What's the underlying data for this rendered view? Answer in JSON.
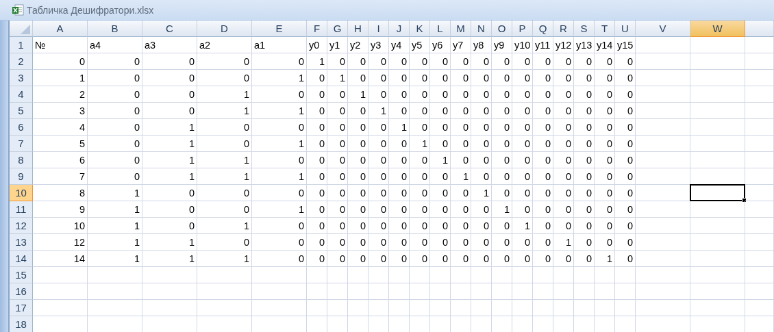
{
  "window": {
    "title": "Табличка Дешифратори.xlsx"
  },
  "columns": [
    {
      "label": "A",
      "selected": false
    },
    {
      "label": "B",
      "selected": false
    },
    {
      "label": "C",
      "selected": false
    },
    {
      "label": "D",
      "selected": false
    },
    {
      "label": "E",
      "selected": false
    },
    {
      "label": "F",
      "selected": false
    },
    {
      "label": "G",
      "selected": false
    },
    {
      "label": "H",
      "selected": false
    },
    {
      "label": "I",
      "selected": false
    },
    {
      "label": "J",
      "selected": false
    },
    {
      "label": "K",
      "selected": false
    },
    {
      "label": "L",
      "selected": false
    },
    {
      "label": "M",
      "selected": false
    },
    {
      "label": "N",
      "selected": false
    },
    {
      "label": "O",
      "selected": false
    },
    {
      "label": "P",
      "selected": false
    },
    {
      "label": "Q",
      "selected": false
    },
    {
      "label": "R",
      "selected": false
    },
    {
      "label": "S",
      "selected": false
    },
    {
      "label": "T",
      "selected": false
    },
    {
      "label": "U",
      "selected": false
    },
    {
      "label": "V",
      "selected": false
    },
    {
      "label": "W",
      "selected": true
    }
  ],
  "rows": [
    {
      "header": "1",
      "selected": false,
      "kind": "text",
      "cells": [
        "№",
        "a4",
        "a3",
        "a2",
        "a1",
        "y0",
        "y1",
        "y2",
        "y3",
        "y4",
        "y5",
        "y6",
        "y7",
        "y8",
        "y9",
        "y10",
        "y11",
        "y12",
        "y13",
        "y14",
        "y15"
      ]
    },
    {
      "header": "2",
      "selected": false,
      "kind": "number",
      "cells": [
        "0",
        "0",
        "0",
        "0",
        "0",
        "1",
        "0",
        "0",
        "0",
        "0",
        "0",
        "0",
        "0",
        "0",
        "0",
        "0",
        "0",
        "0",
        "0",
        "0",
        "0"
      ]
    },
    {
      "header": "3",
      "selected": false,
      "kind": "number",
      "cells": [
        "1",
        "0",
        "0",
        "0",
        "1",
        "0",
        "1",
        "0",
        "0",
        "0",
        "0",
        "0",
        "0",
        "0",
        "0",
        "0",
        "0",
        "0",
        "0",
        "0",
        "0"
      ]
    },
    {
      "header": "4",
      "selected": false,
      "kind": "number",
      "cells": [
        "2",
        "0",
        "0",
        "1",
        "0",
        "0",
        "0",
        "1",
        "0",
        "0",
        "0",
        "0",
        "0",
        "0",
        "0",
        "0",
        "0",
        "0",
        "0",
        "0",
        "0"
      ]
    },
    {
      "header": "5",
      "selected": false,
      "kind": "number",
      "cells": [
        "3",
        "0",
        "0",
        "1",
        "1",
        "0",
        "0",
        "0",
        "1",
        "0",
        "0",
        "0",
        "0",
        "0",
        "0",
        "0",
        "0",
        "0",
        "0",
        "0",
        "0"
      ]
    },
    {
      "header": "6",
      "selected": false,
      "kind": "number",
      "cells": [
        "4",
        "0",
        "1",
        "0",
        "0",
        "0",
        "0",
        "0",
        "0",
        "1",
        "0",
        "0",
        "0",
        "0",
        "0",
        "0",
        "0",
        "0",
        "0",
        "0",
        "0"
      ]
    },
    {
      "header": "7",
      "selected": false,
      "kind": "number",
      "cells": [
        "5",
        "0",
        "1",
        "0",
        "1",
        "0",
        "0",
        "0",
        "0",
        "0",
        "1",
        "0",
        "0",
        "0",
        "0",
        "0",
        "0",
        "0",
        "0",
        "0",
        "0"
      ]
    },
    {
      "header": "8",
      "selected": false,
      "kind": "number",
      "cells": [
        "6",
        "0",
        "1",
        "1",
        "0",
        "0",
        "0",
        "0",
        "0",
        "0",
        "0",
        "1",
        "0",
        "0",
        "0",
        "0",
        "0",
        "0",
        "0",
        "0",
        "0"
      ]
    },
    {
      "header": "9",
      "selected": false,
      "kind": "number",
      "cells": [
        "7",
        "0",
        "1",
        "1",
        "1",
        "0",
        "0",
        "0",
        "0",
        "0",
        "0",
        "0",
        "1",
        "0",
        "0",
        "0",
        "0",
        "0",
        "0",
        "0",
        "0"
      ]
    },
    {
      "header": "10",
      "selected": true,
      "kind": "number",
      "cells": [
        "8",
        "1",
        "0",
        "0",
        "0",
        "0",
        "0",
        "0",
        "0",
        "0",
        "0",
        "0",
        "0",
        "1",
        "0",
        "0",
        "0",
        "0",
        "0",
        "0",
        "0"
      ]
    },
    {
      "header": "11",
      "selected": false,
      "kind": "number",
      "cells": [
        "9",
        "1",
        "0",
        "0",
        "1",
        "0",
        "0",
        "0",
        "0",
        "0",
        "0",
        "0",
        "0",
        "0",
        "1",
        "0",
        "0",
        "0",
        "0",
        "0",
        "0"
      ]
    },
    {
      "header": "12",
      "selected": false,
      "kind": "number",
      "cells": [
        "10",
        "1",
        "0",
        "1",
        "0",
        "0",
        "0",
        "0",
        "0",
        "0",
        "0",
        "0",
        "0",
        "0",
        "0",
        "1",
        "0",
        "0",
        "0",
        "0",
        "0"
      ]
    },
    {
      "header": "13",
      "selected": false,
      "kind": "number",
      "cells": [
        "12",
        "1",
        "1",
        "0",
        "0",
        "0",
        "0",
        "0",
        "0",
        "0",
        "0",
        "0",
        "0",
        "0",
        "0",
        "0",
        "0",
        "1",
        "0",
        "0",
        "0"
      ]
    },
    {
      "header": "14",
      "selected": false,
      "kind": "number",
      "cells": [
        "14",
        "1",
        "1",
        "1",
        "0",
        "0",
        "0",
        "0",
        "0",
        "0",
        "0",
        "0",
        "0",
        "0",
        "0",
        "0",
        "0",
        "0",
        "0",
        "1",
        "0"
      ]
    },
    {
      "header": "15",
      "selected": false
    },
    {
      "header": "16",
      "selected": false
    },
    {
      "header": "17",
      "selected": false
    },
    {
      "header": "18",
      "selected": false
    }
  ]
}
